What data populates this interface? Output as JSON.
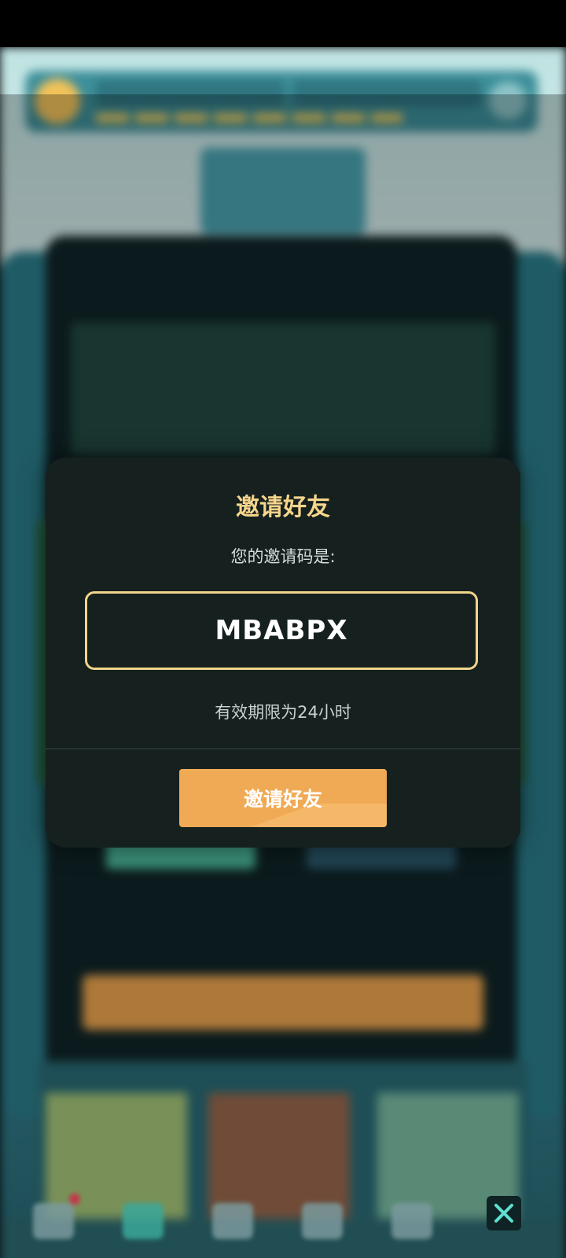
{
  "dialog": {
    "title": "邀请好友",
    "subtitle": "您的邀请码是:",
    "invite_code": "MBABPX",
    "validity": "有效期限为24小时",
    "invite_button": "邀请好友"
  },
  "close_icon": "close-icon",
  "colors": {
    "accent_gold": "#f6d58c",
    "button_orange": "#f0aa55",
    "dialog_bg": "#15201f",
    "close_x": "#5fe0d0"
  }
}
